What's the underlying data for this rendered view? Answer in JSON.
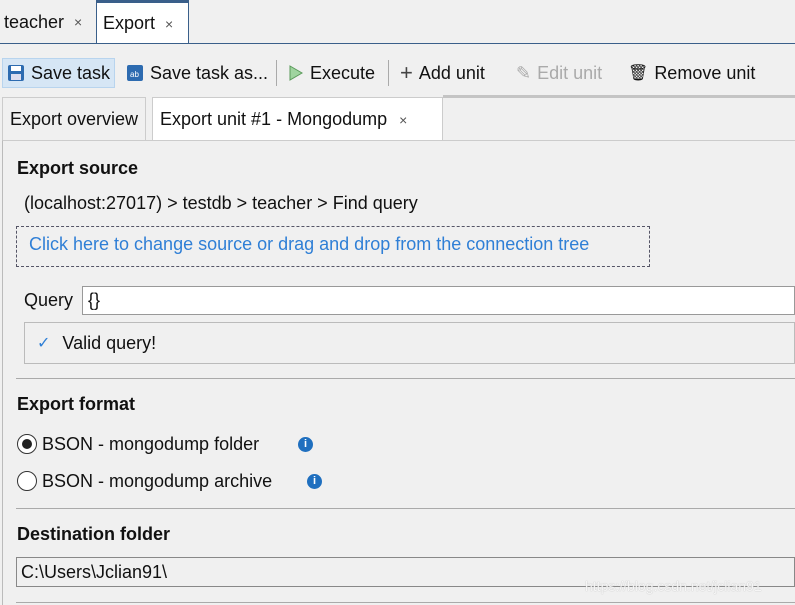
{
  "doc_tabs": [
    {
      "label": "teacher",
      "close": "×"
    },
    {
      "label": "Export",
      "close": "×"
    }
  ],
  "toolbar": {
    "save": "Save task",
    "save_as": "Save task as...",
    "execute": "Execute",
    "add": "Add unit",
    "edit": "Edit unit",
    "remove": "Remove unit"
  },
  "inner_tabs": [
    {
      "label": "Export overview"
    },
    {
      "label": "Export unit #1 - Mongodump",
      "close": "×"
    }
  ],
  "source": {
    "title": "Export source",
    "path": "(localhost:27017) > testdb > teacher > Find query",
    "change_link": "Click here to change source or drag and drop from the connection tree"
  },
  "query": {
    "label": "Query",
    "value": "{}",
    "status": "Valid query!"
  },
  "format": {
    "title": "Export format",
    "options": [
      {
        "label": "BSON - mongodump folder",
        "selected": true
      },
      {
        "label": "BSON - mongodump archive",
        "selected": false
      }
    ]
  },
  "destination": {
    "title": "Destination folder",
    "value": "C:\\Users\\Jclian91\\"
  },
  "watermark": "https://blog.csdn.net/jclian91",
  "colors": {
    "accent": "#3a5f8a",
    "link": "#2f7fd6",
    "info": "#1f6fbf"
  }
}
